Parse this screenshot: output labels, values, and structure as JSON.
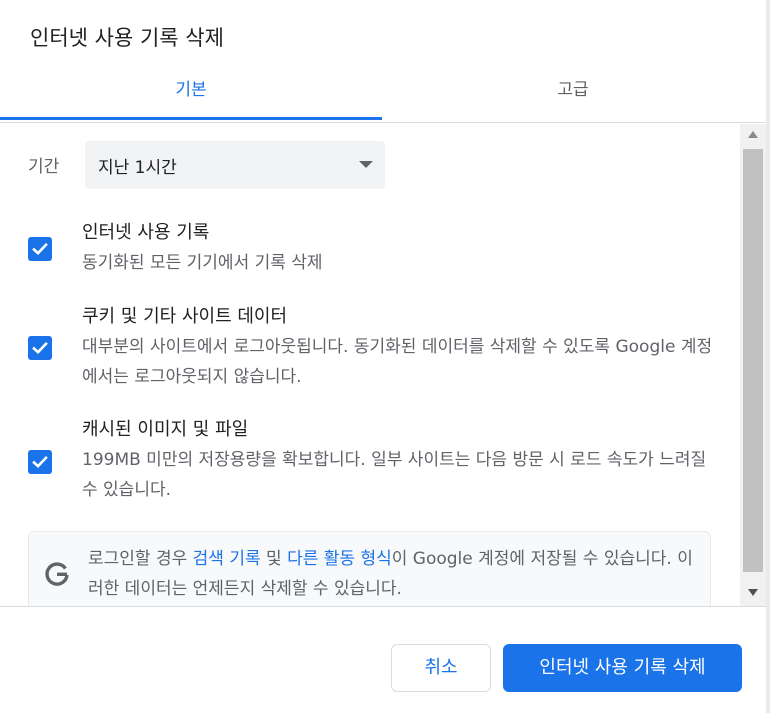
{
  "dialog": {
    "title": "인터넷 사용 기록 삭제"
  },
  "tabs": [
    {
      "label": "기본",
      "active": true
    },
    {
      "label": "고급",
      "active": false
    }
  ],
  "period": {
    "label": "기간",
    "value": "지난 1시간"
  },
  "options": [
    {
      "title": "인터넷 사용 기록",
      "description": "동기화된 모든 기기에서 기록 삭제",
      "checked": true
    },
    {
      "title": "쿠키 및 기타 사이트 데이터",
      "description": "대부분의 사이트에서 로그아웃됩니다. 동기화된 데이터를 삭제할 수 있도록 Google 계정에서는 로그아웃되지 않습니다.",
      "checked": true
    },
    {
      "title": "캐시된 이미지 및 파일",
      "description": "199MB 미만의 저장용량을 확보합니다. 일부 사이트는 다음 방문 시 로드 속도가 느려질 수 있습니다.",
      "checked": true
    }
  ],
  "google_notice": {
    "icon": "google-g-icon",
    "text_before": "로그인할 경우 ",
    "link1": "검색 기록",
    "text_middle": " 및 ",
    "link2": "다른 활동 형식",
    "text_after": "이 Google 계정에 저장될 수 있습니다. 이러한 데이터는 언제든지 삭제할 수 있습니다."
  },
  "footer": {
    "cancel_label": "취소",
    "delete_label": "인터넷 사용 기록 삭제"
  },
  "colors": {
    "accent": "#1a73e8",
    "text_primary": "#202124",
    "text_secondary": "#5f6368",
    "select_bg": "#f1f3f4"
  }
}
